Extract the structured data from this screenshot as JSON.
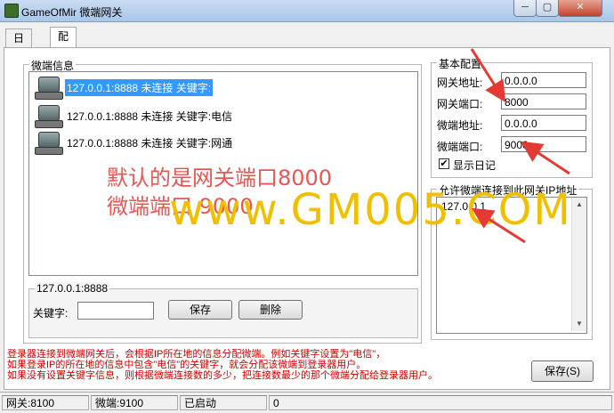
{
  "window": {
    "title": "GameOfMir 微端网关"
  },
  "tabs": [
    {
      "label": "日记"
    },
    {
      "label": "配置"
    }
  ],
  "client_info": {
    "legend": "微端信息",
    "rows": [
      {
        "text": "127.0.0.1:8888 未连接 关键字:",
        "selected": true
      },
      {
        "text": "127.0.0.1:8888 未连接 关键字:电信",
        "selected": false
      },
      {
        "text": "127.0.0.1:8888 未连接 关键字:网通",
        "selected": false
      }
    ]
  },
  "editor": {
    "address": "127.0.0.1:8888",
    "keyword_label": "关键字:",
    "keyword_value": "",
    "save_label": "保存",
    "delete_label": "删除"
  },
  "basic": {
    "legend": "基本配置",
    "gateway_address_label": "网关地址:",
    "gateway_address": "0.0.0.0",
    "gateway_port_label": "网关端口:",
    "gateway_port": "8000",
    "client_address_label": "微端地址:",
    "client_address": "0.0.0.0",
    "client_port_label": "微端端口:",
    "client_port": "9000",
    "show_log_label": "显示日记",
    "show_log_checked": true
  },
  "allowed_ips": {
    "legend": "允许微端连接到此网关IP地址",
    "items": [
      "127.0.0.1"
    ]
  },
  "notes": [
    "登录器连接到微端网关后，会根据IP所在地的信息分配微端。例如关键字设置为\"电信\"，",
    "如果登录IP的所在地的信息中包含\"电信\"的关键字，就会分配该微端到登录器用户。",
    "如果没有设置关键字信息，则根据微端连接数的多少，把连接数最少的那个微端分配给登录器用户。"
  ],
  "bottom_save_label": "保存(S)",
  "status": [
    "网关:8100",
    "微端:9100",
    "已启动",
    "0"
  ],
  "annotation": {
    "line1": "默认的是网关端口8000",
    "line2": "微端端口 9000"
  },
  "watermark": "www.GM005.COM"
}
